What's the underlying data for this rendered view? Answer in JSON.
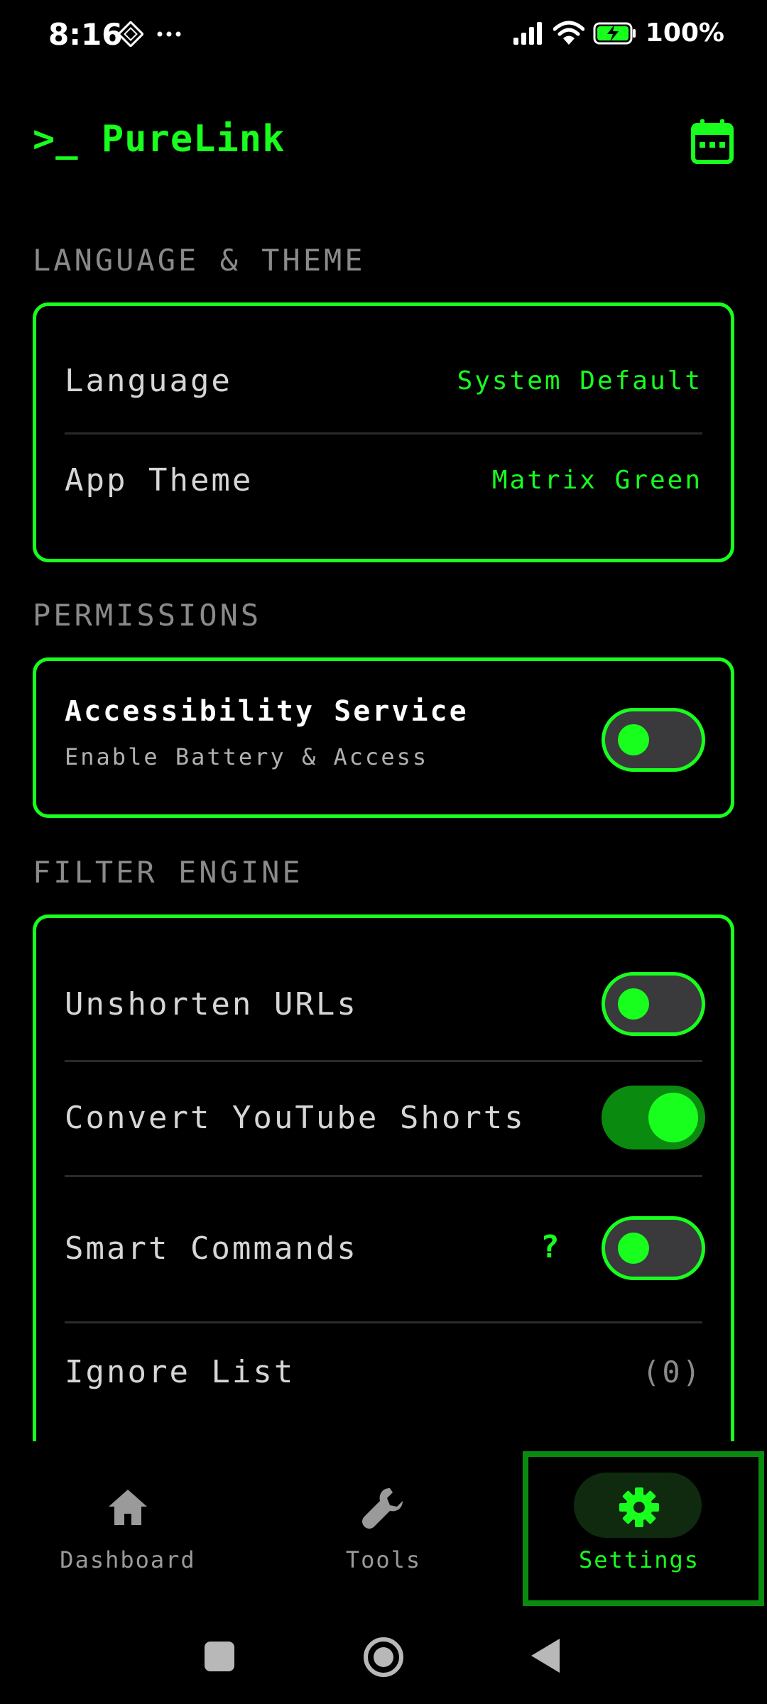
{
  "status_bar": {
    "time": "8:16",
    "battery_percent": "100%"
  },
  "header": {
    "title": ">_ PureLink",
    "calendar_icon": "calendar-icon"
  },
  "sections": {
    "language_theme": {
      "title": "LANGUAGE & THEME",
      "language_label": "Language",
      "language_value": "System Default",
      "theme_label": "App Theme",
      "theme_value": "Matrix Green"
    },
    "permissions": {
      "title": "PERMISSIONS",
      "accessibility_label": "Accessibility Service",
      "accessibility_sub": "Enable Battery & Access",
      "accessibility_enabled": false
    },
    "filter_engine": {
      "title": "FILTER ENGINE",
      "unshorten_label": "Unshorten URLs",
      "unshorten_enabled": false,
      "youtube_label": "Convert YouTube Shorts",
      "youtube_enabled": true,
      "smart_label": "Smart Commands",
      "smart_help": "?",
      "smart_enabled": false,
      "ignore_label": "Ignore List",
      "ignore_count": "(0)"
    }
  },
  "bottom_nav": {
    "items": [
      {
        "label": "Dashboard",
        "icon": "home-icon"
      },
      {
        "label": "Tools",
        "icon": "wrench-icon"
      },
      {
        "label": "Settings",
        "icon": "gear-icon"
      }
    ],
    "active": "Settings"
  },
  "colors": {
    "accent": "#18ff1e",
    "toggle_on_track": "#0a8a0e",
    "toggle_off_track": "#3a3a3c",
    "background": "#000000"
  }
}
